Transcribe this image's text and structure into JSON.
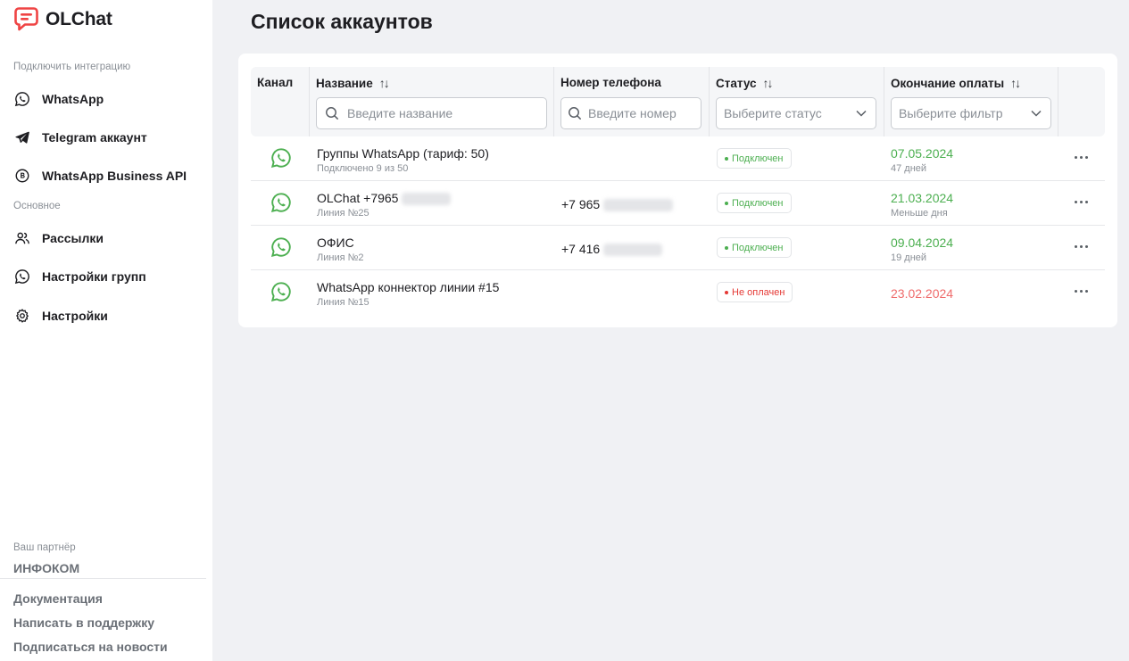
{
  "app": {
    "title": "OLChat",
    "brand_color": "#ef4444",
    "accent_color": "#4caf50"
  },
  "sidebar": {
    "sections": [
      {
        "label": "Подключить интеграцию",
        "items": [
          {
            "label": "WhatsApp",
            "icon": "whatsapp-icon"
          },
          {
            "label": "Telegram аккаунт",
            "icon": "telegram-icon"
          },
          {
            "label": "WhatsApp Business API",
            "icon": "business-api-icon"
          }
        ]
      },
      {
        "label": "Основное",
        "items": [
          {
            "label": "Рассылки",
            "icon": "users-icon"
          },
          {
            "label": "Настройки групп",
            "icon": "whatsapp-icon"
          },
          {
            "label": "Настройки",
            "icon": "gear-icon"
          }
        ]
      }
    ],
    "partner_label": "Ваш партнёр",
    "partner_name": "ИНФОКОМ",
    "footer_links": [
      "Документация",
      "Написать в поддержку",
      "Подписаться на новости"
    ]
  },
  "main": {
    "title": "Список аккаунтов",
    "columns": [
      {
        "label": "Канал",
        "sortable": false
      },
      {
        "label": "Название",
        "sortable": true,
        "filter_placeholder": "Введите название"
      },
      {
        "label": "Номер телефона",
        "sortable": false,
        "filter_placeholder": "Введите номер"
      },
      {
        "label": "Статус",
        "sortable": true,
        "filter_placeholder": "Выберите статус"
      },
      {
        "label": "Окончание оплаты",
        "sortable": true,
        "filter_placeholder": "Выберите фильтр"
      }
    ],
    "rows": [
      {
        "channel": "whatsapp-icon",
        "name": "Группы WhatsApp (тариф: 50)",
        "sub": "Подключено 9 из 50",
        "phone": "",
        "status": "Подключен",
        "status_type": "ok",
        "date": "07.05.2024",
        "date_sub": "47 дней"
      },
      {
        "channel": "whatsapp-icon",
        "name": "OLChat +7965",
        "sub": "Линия №25",
        "phone": "+7 965",
        "status": "Подключен",
        "status_type": "ok",
        "date": "21.03.2024",
        "date_sub": "Меньше дня"
      },
      {
        "channel": "whatsapp-icon",
        "name": "ОФИС",
        "sub": "Линия №2",
        "phone": "+7 416",
        "status": "Подключен",
        "status_type": "ok",
        "date": "09.04.2024",
        "date_sub": "19 дней"
      },
      {
        "channel": "whatsapp-icon",
        "name": "WhatsApp коннектор линии #15",
        "sub": "Линия №15",
        "phone": "",
        "status": "Не оплачен",
        "status_type": "bad",
        "date": "23.02.2024",
        "date_sub": ""
      }
    ]
  }
}
